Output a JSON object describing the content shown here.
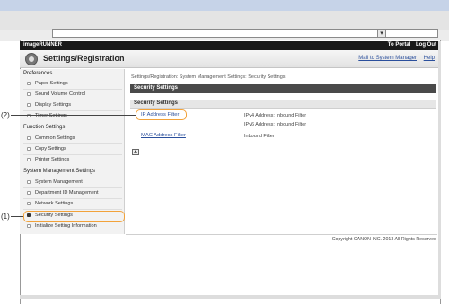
{
  "browser": {
    "address_dropdown_glyph": "▾"
  },
  "app": {
    "brand": "imageRUNNER",
    "top_links": {
      "portal": "To Portal",
      "logout": "Log Out"
    },
    "title": "Settings/Registration",
    "mail_link": "Mail to System Manager",
    "help_link": "Help"
  },
  "sidebar": {
    "preferences": {
      "heading": "Preferences",
      "items": [
        "Paper Settings",
        "Sound Volume Control",
        "Display Settings",
        "Timer Settings"
      ]
    },
    "function": {
      "heading": "Function Settings",
      "items": [
        "Common Settings",
        "Copy Settings",
        "Printer Settings"
      ]
    },
    "system": {
      "heading": "System Management Settings",
      "items": [
        "System Management",
        "Department ID Management",
        "Network Settings",
        "Security Settings",
        "Initialize Setting Information"
      ]
    },
    "selected_item": "Security Settings"
  },
  "main": {
    "breadcrumb": "Settings/Registration: System Management Settings: Security Settings",
    "header": "Security Settings",
    "section_header": "Security Settings",
    "rows": [
      {
        "link": "IP Address Filter",
        "values": [
          "IPv4 Address: Inbound Filter",
          "IPv6 Address: Inbound Filter"
        ]
      },
      {
        "link": "MAC Address Filter",
        "values": [
          "Inbound Filter"
        ]
      }
    ],
    "top_button": "▲",
    "copyright": "Copyright CANON INC. 2013 All Rights Reserved"
  },
  "callouts": [
    {
      "label": "(1)",
      "target": "Security Settings"
    },
    {
      "label": "(2)",
      "target": "IP Address Filter"
    }
  ],
  "colors": {
    "callout": "#f2a23a",
    "link": "#2a4f9c",
    "header": "#4a4a4a",
    "appbar": "#1a1a1a"
  }
}
